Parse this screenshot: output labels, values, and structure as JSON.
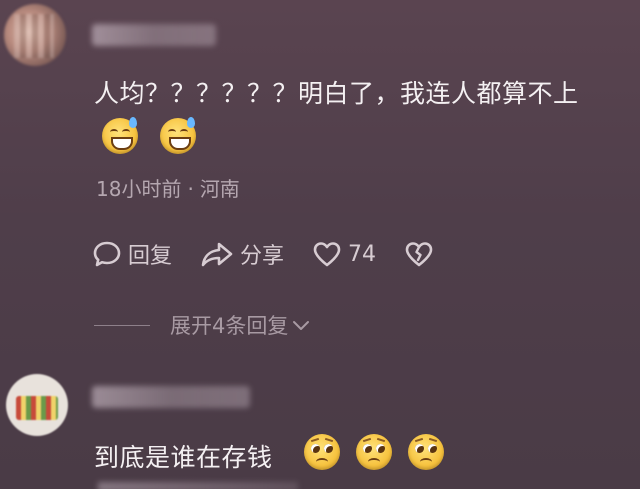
{
  "comments": [
    {
      "text": "人均？？？？？？明白了，我连人都算不上",
      "emojis": [
        "grin-sweat-icon",
        "grin-sweat-icon"
      ],
      "meta": {
        "time": "18小时前",
        "separator": "·",
        "location": "河南"
      },
      "actions": {
        "reply_label": "回复",
        "share_label": "分享",
        "like_count": "74"
      },
      "expand_label": "展开4条回复"
    },
    {
      "text": "到底是谁在存钱",
      "emojis": [
        "pleading-face-icon",
        "pleading-face-icon",
        "pleading-face-icon"
      ]
    }
  ],
  "colors": {
    "background": "#4f3e4a",
    "primary_text": "#f4f0f2",
    "secondary_text": "#b5a7b0",
    "emoji_yellow": "#f6c23e"
  }
}
